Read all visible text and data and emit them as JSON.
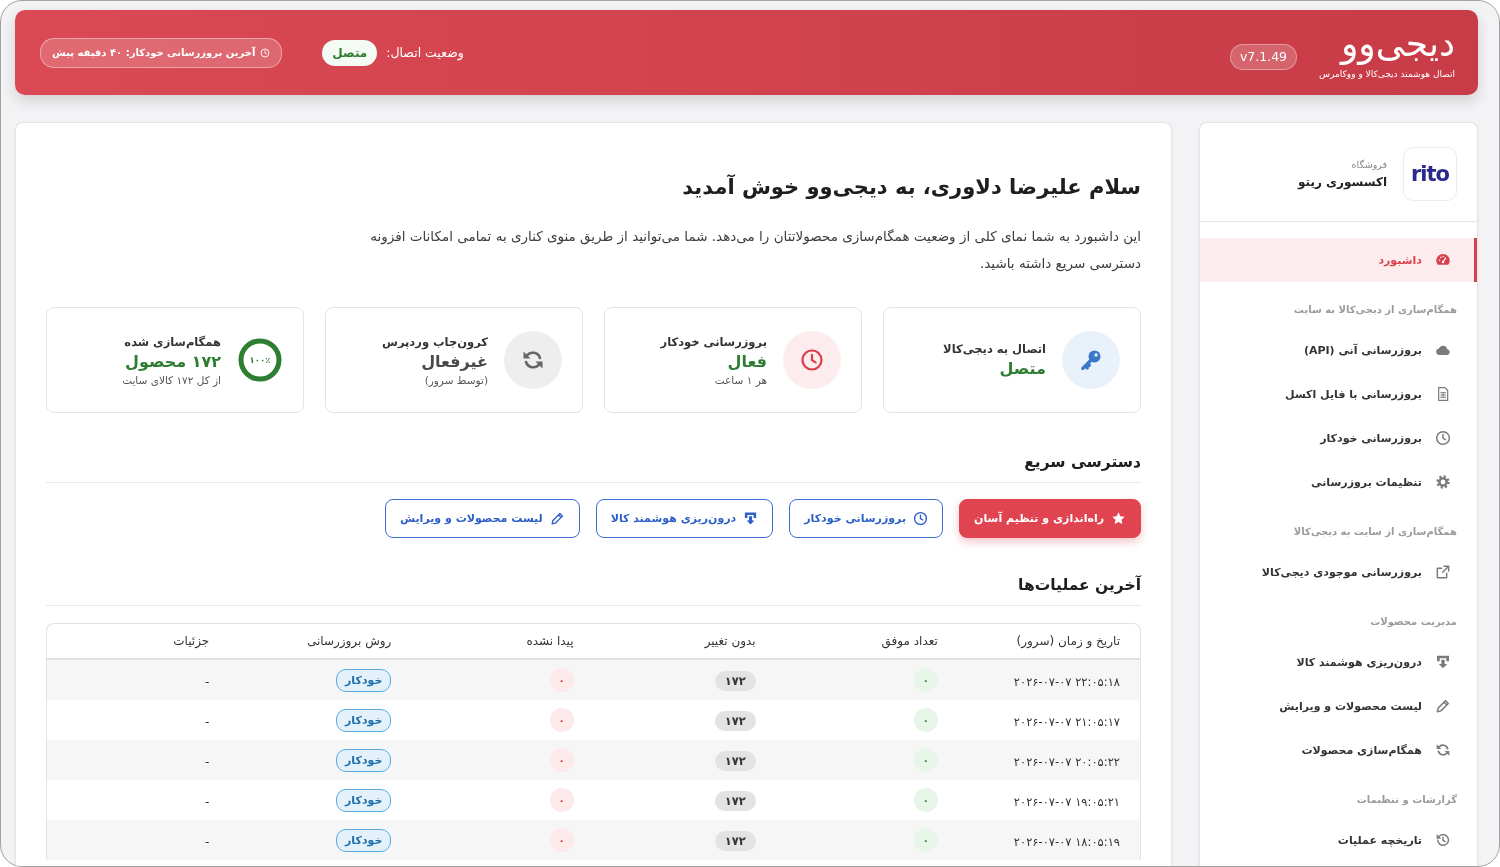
{
  "header": {
    "logo": "دیجی‌وو",
    "tagline": "اتصال هوشمند دیجی‌کالا و ووکامرس",
    "version": "v7.1.49",
    "connection_label": "وضعیت اتصال:",
    "connection_status": "متصل",
    "last_update": "آخرین بروزرسانی خودکار: ۴۰ دقیقه پیش"
  },
  "sidebar": {
    "store": {
      "logo": "rito",
      "caption": "فروشگاه",
      "name": "اکسسوری ریتو"
    },
    "sections": [
      {
        "items": [
          {
            "label": "داشبورد",
            "selected": true
          }
        ]
      },
      {
        "heading": "همگام‌سازی از دیجی‌کالا به سایت",
        "items": [
          {
            "label": "بروزرسانی آنی (API)",
            "selected": false
          },
          {
            "label": "بروزرسانی با فایل اکسل",
            "selected": false
          },
          {
            "label": "بروزرسانی خودکار",
            "selected": false
          },
          {
            "label": "تنظیمات بروزرسانی",
            "selected": false
          }
        ]
      },
      {
        "heading": "همگام‌سازی از سایت به دیجی‌کالا",
        "items": [
          {
            "label": "بروزرسانی موجودی دیجی‌کالا",
            "selected": false
          }
        ]
      },
      {
        "heading": "مدیریت محصولات",
        "items": [
          {
            "label": "درون‌ریزی هوشمند کالا",
            "selected": false
          },
          {
            "label": "لیست محصولات و ویرایش",
            "selected": false
          },
          {
            "label": "همگام‌سازی محصولات",
            "selected": false
          }
        ]
      },
      {
        "heading": "گزارشات و تنظیمات",
        "items": [
          {
            "label": "تاریخچه عملیات",
            "selected": false
          }
        ]
      }
    ]
  },
  "main": {
    "title": "سلام علیرضا دلاوری، به دیجی‌وو خوش آمدید",
    "intro": "این داشبورد به شما نمای کلی از وضعیت همگام‌سازی محصولاتتان را می‌دهد. شما می‌توانید از طریق منوی کناری به تمامی امکانات افزونه دسترسی سریع داشته باشید.",
    "stat_cards": [
      {
        "kind": "icon",
        "label": "اتصال به دیجی‌کالا",
        "value": "متصل",
        "positive": true
      },
      {
        "kind": "icon",
        "label": "بروزرسانی خودکار",
        "value": "فعال",
        "positive": true,
        "note": "هر ۱ ساعت"
      },
      {
        "kind": "icon",
        "label": "کرون‌جاب وردپرس",
        "value": "غیرفعال",
        "positive": false,
        "note": "(توسط سرور)"
      },
      {
        "kind": "progress",
        "label": "همگام‌سازی شده",
        "value": "۱۷۲ محصول",
        "positive": true,
        "note": "از کل ۱۷۲ کالای سایت",
        "level": 1,
        "percent": "۱۰۰٪"
      }
    ],
    "quick_access": {
      "title": "دسترسی سریع",
      "buttons": [
        {
          "kind": "primary",
          "label": "راه‌اندازی و تنظیم آسان"
        },
        {
          "kind": "outline",
          "label": "بروزرسانی خودکار"
        },
        {
          "kind": "outline",
          "label": "درون‌ریزی هوشمند کالا"
        },
        {
          "kind": "outline",
          "label": "لیست محصولات و ویرایش"
        }
      ]
    },
    "recent": {
      "title": "آخرین عملیات‌ها",
      "table": {
        "columns": [
          "تاریخ و زمان (سرور)",
          "تعداد موفق",
          "بدون تغییر",
          "پیدا نشده",
          "روش بروزرسانی",
          "جزئیات"
        ],
        "rows": [
          {
            "cells": [
              "۲۰۲۶-۰۷-۰۷ ۲۲:۰۵:۱۸",
              "۰",
              "۱۷۲",
              "۰",
              "خودکار",
              "-"
            ]
          },
          {
            "cells": [
              "۲۰۲۶-۰۷-۰۷ ۲۱:۰۵:۱۷",
              "۰",
              "۱۷۲",
              "۰",
              "خودکار",
              "-"
            ]
          },
          {
            "cells": [
              "۲۰۲۶-۰۷-۰۷ ۲۰:۰۵:۲۲",
              "۰",
              "۱۷۲",
              "۰",
              "خودکار",
              "-"
            ]
          },
          {
            "cells": [
              "۲۰۲۶-۰۷-۰۷ ۱۹:۰۵:۲۱",
              "۰",
              "۱۷۲",
              "۰",
              "خودکار",
              "-"
            ]
          },
          {
            "cells": [
              "۲۰۲۶-۰۷-۰۷ ۱۸:۰۵:۱۹",
              "۰",
              "۱۷۲",
              "۰",
              "خودکار",
              "-"
            ]
          }
        ]
      }
    }
  }
}
